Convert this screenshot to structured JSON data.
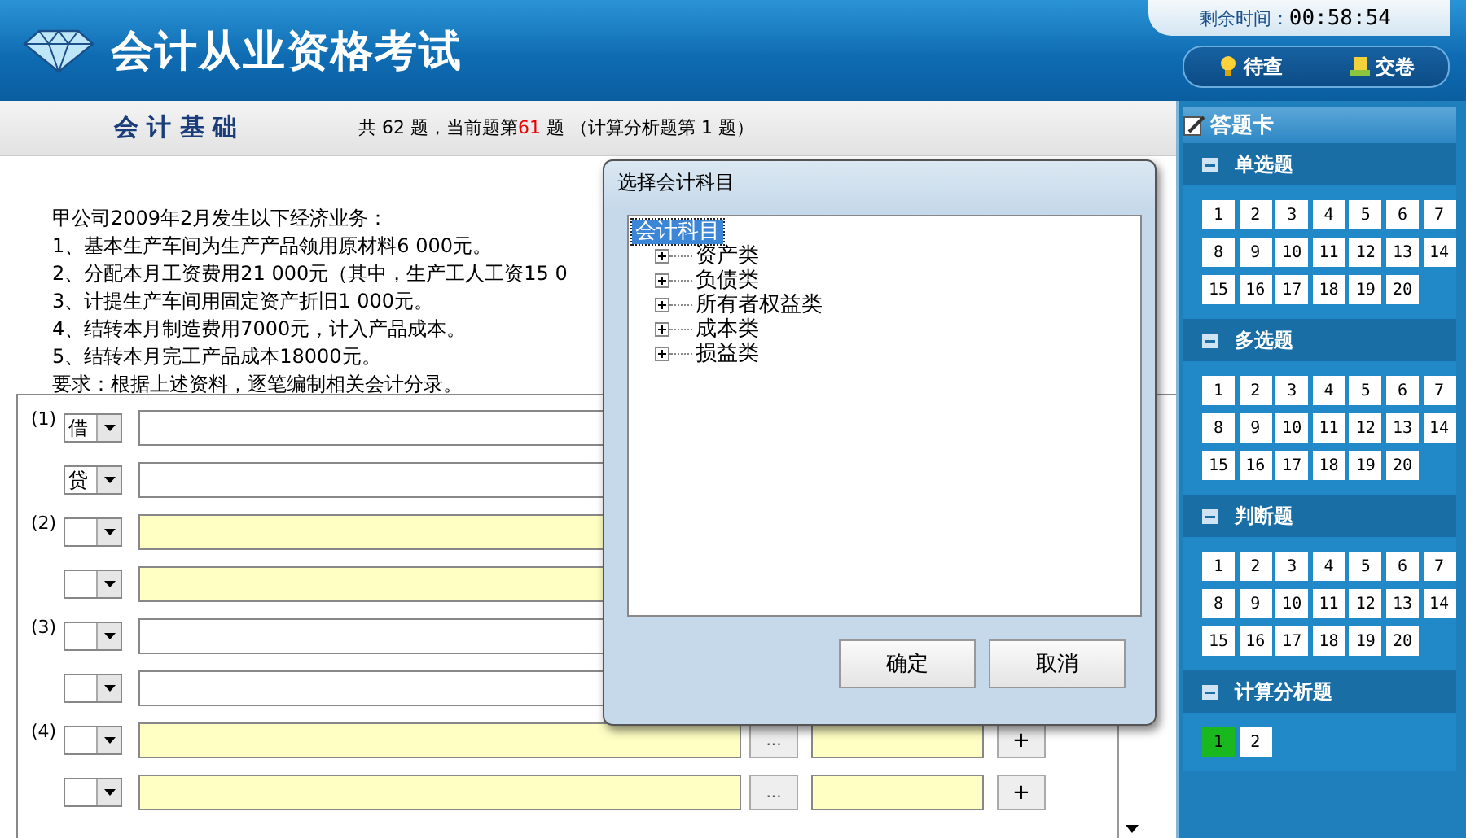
{
  "header": {
    "title": "会计从业资格考试",
    "timer_label": "剩余时间：",
    "timer": "00:58:54",
    "buttons": [
      {
        "kind": "review",
        "label": "待查"
      },
      {
        "kind": "submit",
        "label": "交卷"
      }
    ]
  },
  "subject": {
    "name": "会 计 基 础",
    "progress_prefix": "共 62 题，当前题第",
    "progress_current": "61",
    "current_highlight": true,
    "progress_suffix": " 题 （计算分析题第 1 题）"
  },
  "question": {
    "lines": [
      "甲公司2009年2月发生以下经济业务：",
      "1、基本生产车间为生产产品领用原材料6 000元。",
      "2、分配本月工资费用21 000元（其中，生产工人工资15 0",
      "3、计提生产车间用固定资产折旧1 000元。",
      "4、结转本月制造费用7000元，计入产品成本。",
      "5、结转本月完工产品成本18000元。",
      "要求：根据上述资料，逐笔编制相关会计分录。"
    ]
  },
  "entries": [
    {
      "label": "(1)",
      "highlight": false,
      "lines": [
        {
          "kind": "plain",
          "side": "借"
        },
        {
          "kind": "plain",
          "side": "贷"
        }
      ]
    },
    {
      "label": "(2)",
      "highlight": true,
      "lines": [
        {
          "kind": "plain"
        },
        {
          "kind": "plain"
        }
      ]
    },
    {
      "label": "(3)",
      "highlight": false,
      "lines": [
        {
          "kind": "plain"
        },
        {
          "kind": "plain"
        }
      ]
    },
    {
      "label": "(4)",
      "highlight": true,
      "lines": [
        {
          "kind": "tools",
          "browse": "...",
          "add": "+"
        },
        {
          "kind": "tools",
          "browse": "...",
          "add": "+"
        }
      ]
    }
  ],
  "dialog": {
    "title": "选择会计科目",
    "tree": [
      {
        "label": "会计科目",
        "selected": true,
        "children": [
          {
            "label": "资产类",
            "selected": false,
            "expanded": false
          },
          {
            "label": "负债类",
            "selected": false,
            "expanded": false
          },
          {
            "label": "所有者权益类",
            "selected": false,
            "expanded": false
          },
          {
            "label": "成本类",
            "selected": false,
            "expanded": false
          },
          {
            "label": "损益类",
            "selected": false,
            "expanded": false
          }
        ]
      }
    ],
    "buttons": [
      "确定",
      "取消"
    ]
  },
  "answer_card": {
    "title": "答题卡",
    "sections": [
      {
        "title": "单选题",
        "items": [
          {
            "n": "1",
            "selected": false
          },
          {
            "n": "2",
            "selected": false
          },
          {
            "n": "3",
            "selected": false
          },
          {
            "n": "4",
            "selected": false
          },
          {
            "n": "5",
            "selected": false
          },
          {
            "n": "6",
            "selected": false
          },
          {
            "n": "7",
            "selected": false
          },
          {
            "n": "8",
            "selected": false
          },
          {
            "n": "9",
            "selected": false
          },
          {
            "n": "10",
            "selected": false
          },
          {
            "n": "11",
            "selected": false
          },
          {
            "n": "12",
            "selected": false
          },
          {
            "n": "13",
            "selected": false
          },
          {
            "n": "14",
            "selected": false
          },
          {
            "n": "15",
            "selected": false
          },
          {
            "n": "16",
            "selected": false
          },
          {
            "n": "17",
            "selected": false
          },
          {
            "n": "18",
            "selected": false
          },
          {
            "n": "19",
            "selected": false
          },
          {
            "n": "20",
            "selected": false
          }
        ]
      },
      {
        "title": "多选题",
        "items": [
          {
            "n": "1",
            "selected": false
          },
          {
            "n": "2",
            "selected": false
          },
          {
            "n": "3",
            "selected": false
          },
          {
            "n": "4",
            "selected": false
          },
          {
            "n": "5",
            "selected": false
          },
          {
            "n": "6",
            "selected": false
          },
          {
            "n": "7",
            "selected": false
          },
          {
            "n": "8",
            "selected": false
          },
          {
            "n": "9",
            "selected": false
          },
          {
            "n": "10",
            "selected": false
          },
          {
            "n": "11",
            "selected": false
          },
          {
            "n": "12",
            "selected": false
          },
          {
            "n": "13",
            "selected": false
          },
          {
            "n": "14",
            "selected": false
          },
          {
            "n": "15",
            "selected": false
          },
          {
            "n": "16",
            "selected": false
          },
          {
            "n": "17",
            "selected": false
          },
          {
            "n": "18",
            "selected": false
          },
          {
            "n": "19",
            "selected": false
          },
          {
            "n": "20",
            "selected": false
          }
        ]
      },
      {
        "title": "判断题",
        "items": [
          {
            "n": "1",
            "selected": false
          },
          {
            "n": "2",
            "selected": false
          },
          {
            "n": "3",
            "selected": false
          },
          {
            "n": "4",
            "selected": false
          },
          {
            "n": "5",
            "selected": false
          },
          {
            "n": "6",
            "selected": false
          },
          {
            "n": "7",
            "selected": false
          },
          {
            "n": "8",
            "selected": false
          },
          {
            "n": "9",
            "selected": false
          },
          {
            "n": "10",
            "selected": false
          },
          {
            "n": "11",
            "selected": false
          },
          {
            "n": "12",
            "selected": false
          },
          {
            "n": "13",
            "selected": false
          },
          {
            "n": "14",
            "selected": false
          },
          {
            "n": "15",
            "selected": false
          },
          {
            "n": "16",
            "selected": false
          },
          {
            "n": "17",
            "selected": false
          },
          {
            "n": "18",
            "selected": false
          },
          {
            "n": "19",
            "selected": false
          },
          {
            "n": "20",
            "selected": false
          }
        ]
      },
      {
        "title": "计算分析题",
        "items": [
          {
            "n": "1",
            "selected": true
          },
          {
            "n": "2",
            "selected": false
          }
        ]
      }
    ]
  }
}
